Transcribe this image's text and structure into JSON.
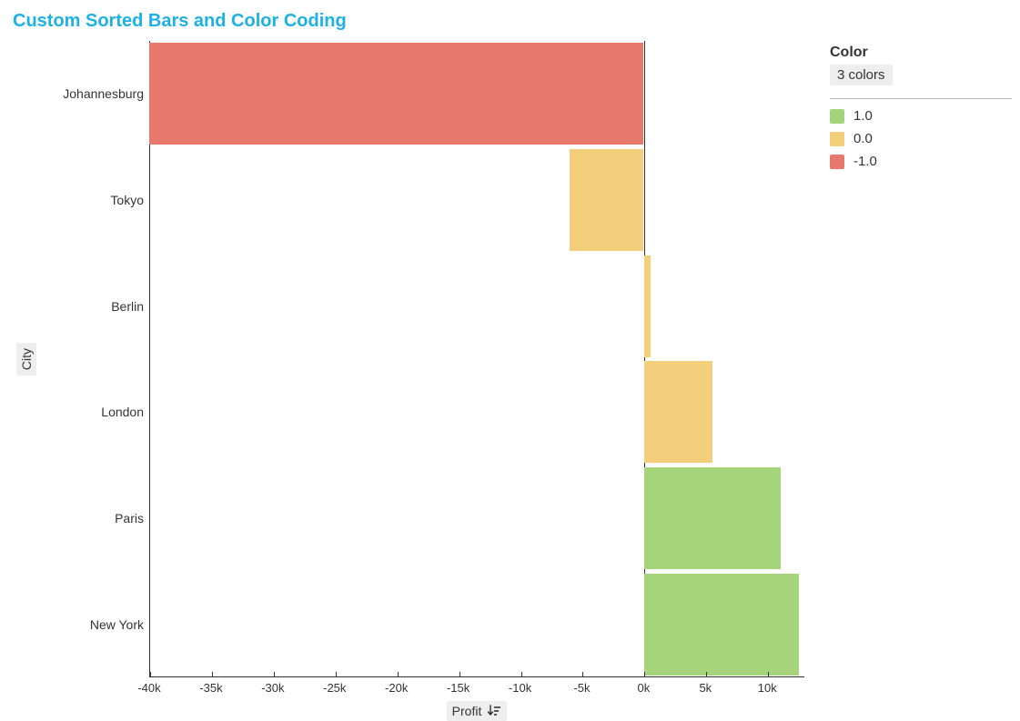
{
  "title": "Custom Sorted Bars and Color Coding",
  "y_axis_title": "City",
  "x_axis_title": "Profit",
  "legend": {
    "title": "Color",
    "summary": "3 colors",
    "items": [
      {
        "label": "1.0",
        "color": "#a6d47a"
      },
      {
        "label": "0.0",
        "color": "#f3ce7b"
      },
      {
        "label": "-1.0",
        "color": "#e77a6c"
      }
    ]
  },
  "chart_data": {
    "type": "bar",
    "orientation": "horizontal",
    "xlabel": "Profit",
    "ylabel": "City",
    "xlim": [
      -40000,
      13000
    ],
    "x_ticks": [
      "-40k",
      "-35k",
      "-30k",
      "-25k",
      "-20k",
      "-15k",
      "-10k",
      "-5k",
      "0k",
      "5k",
      "10k"
    ],
    "categories": [
      "Johannesburg",
      "Tokyo",
      "Berlin",
      "London",
      "Paris",
      "New York"
    ],
    "values": [
      -40000,
      -6000,
      500,
      5500,
      11000,
      12500
    ],
    "color_codes": [
      -1.0,
      0.0,
      0.0,
      0.0,
      1.0,
      1.0
    ],
    "color_map": {
      "-1.0": "#e77a6c",
      "0.0": "#f3ce7b",
      "1.0": "#a6d47a"
    }
  }
}
